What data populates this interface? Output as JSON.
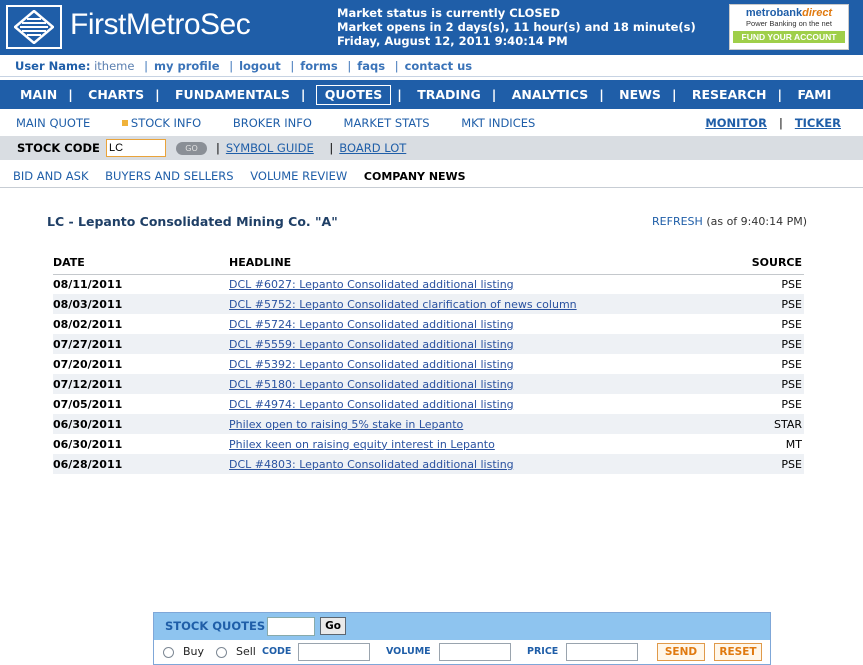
{
  "header": {
    "logo_text": "FirstMetroSec",
    "status_line1": "Market status is currently CLOSED",
    "status_line2": "Market opens in 2 days(s), 11 hour(s) and 18 minute(s)",
    "status_line3": "Friday, August 12, 2011 9:40:14 PM",
    "ad": {
      "brand_a": "metrobank",
      "brand_b": "direct",
      "tagline": "Power Banking on the net",
      "cta": "FUND YOUR ACCOUNT"
    }
  },
  "userbar": {
    "label": "User Name:",
    "username": "itheme",
    "links": [
      "my profile",
      "logout",
      "forms",
      "faqs",
      "contact us"
    ]
  },
  "mainnav": {
    "items": [
      "MAIN",
      "CHARTS",
      "FUNDAMENTALS",
      "QUOTES",
      "TRADING",
      "ANALYTICS",
      "NEWS",
      "RESEARCH",
      "FAMI"
    ],
    "selected": "QUOTES"
  },
  "subnav": {
    "items": [
      "MAIN QUOTE",
      "STOCK INFO",
      "BROKER INFO",
      "MARKET STATS",
      "MKT INDICES"
    ],
    "right": [
      "MONITOR",
      "TICKER"
    ]
  },
  "codebar": {
    "label": "STOCK CODE",
    "value": "LC",
    "go": "GO",
    "links": [
      "SYMBOL GUIDE",
      "BOARD LOT"
    ]
  },
  "tabs": {
    "items": [
      "BID AND ASK",
      "BUYERS AND SELLERS",
      "VOLUME REVIEW",
      "COMPANY NEWS"
    ],
    "selected": "COMPANY NEWS"
  },
  "content": {
    "title": "LC - Lepanto Consolidated Mining Co. \"A\"",
    "refresh": "REFRESH",
    "as_of": "(as of 9:40:14 PM)",
    "columns": [
      "DATE",
      "HEADLINE",
      "SOURCE"
    ],
    "rows": [
      {
        "date": "08/11/2011",
        "headline": "DCL #6027: Lepanto Consolidated additional listing",
        "source": "PSE"
      },
      {
        "date": "08/03/2011",
        "headline": "DCL #5752: Lepanto Consolidated clarification of news column",
        "source": "PSE"
      },
      {
        "date": "08/02/2011",
        "headline": "DCL #5724: Lepanto Consolidated additional listing",
        "source": "PSE"
      },
      {
        "date": "07/27/2011",
        "headline": "DCL #5559: Lepanto Consolidated additional listing",
        "source": "PSE"
      },
      {
        "date": "07/20/2011",
        "headline": "DCL #5392: Lepanto Consolidated additional listing",
        "source": "PSE"
      },
      {
        "date": "07/12/2011",
        "headline": "DCL #5180: Lepanto Consolidated additional listing",
        "source": "PSE"
      },
      {
        "date": "07/05/2011",
        "headline": "DCL #4974: Lepanto Consolidated additional listing",
        "source": "PSE"
      },
      {
        "date": "06/30/2011",
        "headline": "Philex open to raising 5% stake in Lepanto",
        "source": "STAR"
      },
      {
        "date": "06/30/2011",
        "headline": "Philex keen on raising equity interest in Lepanto",
        "source": "MT"
      },
      {
        "date": "06/28/2011",
        "headline": "DCL #4803: Lepanto Consolidated additional listing",
        "source": "PSE"
      }
    ]
  },
  "quotes_panel": {
    "title": "STOCK QUOTES",
    "go": "Go",
    "buy": "Buy",
    "sell": "Sell",
    "code_label": "CODE",
    "volume_label": "VOLUME",
    "price_label": "PRICE",
    "send": "SEND",
    "reset": "RESET"
  }
}
